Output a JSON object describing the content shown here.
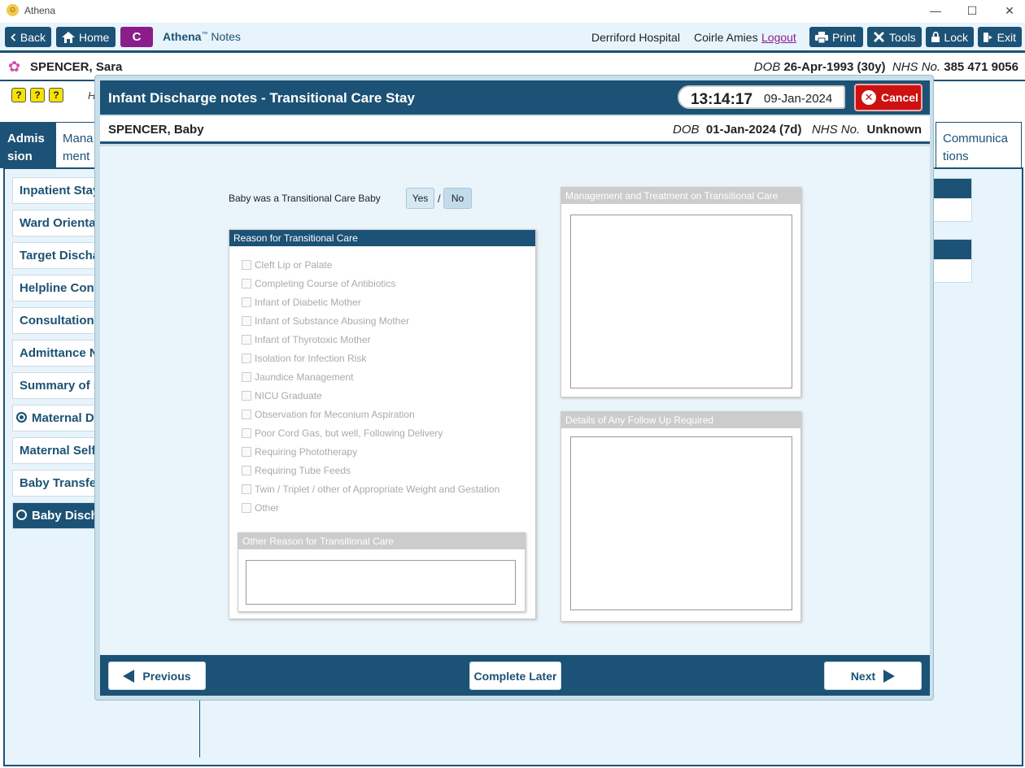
{
  "window": {
    "title": "Athena"
  },
  "toolbar": {
    "back": "Back",
    "home": "Home",
    "c_button": "C",
    "app_name": "Athena",
    "app_tm": "™",
    "app_suffix": "Notes",
    "hospital": "Derriford Hospital",
    "user": "Coirle Amies",
    "logout": "Logout",
    "print": "Print",
    "tools": "Tools",
    "lock": "Lock",
    "exit": "Exit"
  },
  "patient": {
    "name": "SPENCER, Sara",
    "dob_label": "DOB",
    "dob": "26-Apr-1993 (30y)",
    "nhs_label": "NHS No.",
    "nhs": "385 471 9056"
  },
  "background": {
    "quick_icons": [
      "?",
      "?",
      "?"
    ],
    "partial_letter": "H",
    "tabs": {
      "admission": "Admis sion",
      "management": "Mana ment",
      "communications": "Communica tions"
    },
    "sidebar": [
      {
        "label": "Inpatient Stay",
        "state": "normal"
      },
      {
        "label": "Ward Orientat",
        "state": "normal"
      },
      {
        "label": "Target Dischar",
        "state": "normal"
      },
      {
        "label": "Helpline Cont",
        "state": "normal"
      },
      {
        "label": "Consultation I",
        "state": "normal"
      },
      {
        "label": "Admittance N",
        "state": "normal"
      },
      {
        "label": "Summary of P",
        "state": "normal"
      },
      {
        "label": "Maternal Di",
        "state": "radio-on"
      },
      {
        "label": "Maternal Self",
        "state": "normal"
      },
      {
        "label": "Baby Transfer",
        "state": "normal"
      },
      {
        "label": "Baby Discha",
        "state": "active"
      }
    ]
  },
  "modal": {
    "title": "Infant Discharge notes - Transitional Care Stay",
    "time": "13:14:17",
    "date": "09-Jan-2024",
    "cancel": "Cancel",
    "baby": {
      "name": "SPENCER, Baby",
      "dob_label": "DOB",
      "dob": "01-Jan-2024 (7d)",
      "nhs_label": "NHS No.",
      "nhs": "Unknown"
    },
    "question": "Baby was a Transitional Care Baby",
    "yes": "Yes",
    "no": "No",
    "slash": "/",
    "reason_header": "Reason for Transitional Care",
    "reasons": [
      "Cleft Lip or Palate",
      "Completing Course of Antibiotics",
      "Infant of Diabetic Mother",
      "Infant of Substance Abusing Mother",
      "Infant of Thyrotoxic Mother",
      "Isolation for Infection Risk",
      "Jaundice Management",
      "NICU Graduate",
      "Observation for Meconium Aspiration",
      "Poor Cord Gas, but well, Following Delivery",
      "Requiring Phototherapy",
      "Requiring Tube Feeds",
      "Twin / Triplet / other of Appropriate Weight and Gestation",
      "Other"
    ],
    "other_reason_header": "Other Reason for Transitional Care",
    "management_header": "Management and Treatment on Transitional Care",
    "followup_header": "Details of Any Follow Up Required",
    "previous": "Previous",
    "complete_later": "Complete Later",
    "next": "Next"
  },
  "colors": {
    "primary": "#1c5275",
    "accent": "#8b1d8b",
    "cancel": "#cc1111",
    "panel_bg": "#eaf4fb"
  }
}
